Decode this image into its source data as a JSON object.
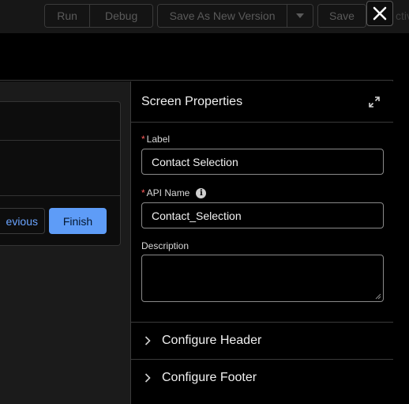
{
  "toolbar": {
    "run_label": "Run",
    "debug_label": "Debug",
    "save_as_new_version_label": "Save As New Version",
    "save_label": "Save",
    "trailing_text": "ctiv"
  },
  "preview": {
    "previous_label": "evious",
    "finish_label": "Finish"
  },
  "panel": {
    "title": "Screen Properties",
    "label_field": {
      "label": "Label",
      "required_mark": "*",
      "value": "Contact Selection"
    },
    "api_name_field": {
      "label": "API Name",
      "required_mark": "*",
      "info_glyph": "i",
      "value": "Contact_Selection"
    },
    "description_field": {
      "label": "Description",
      "value": ""
    },
    "sections": [
      {
        "label": "Configure Header",
        "icon": "chevron-right-icon"
      },
      {
        "label": "Configure Footer",
        "icon": "chevron-right-icon"
      }
    ]
  },
  "colors": {
    "finish_button": "#5e9cf7",
    "link_blue": "#6aa4ff",
    "required_red": "#ff5d5d",
    "panel_bg": "#000000",
    "canvas_bg": "#1b1b1b"
  }
}
